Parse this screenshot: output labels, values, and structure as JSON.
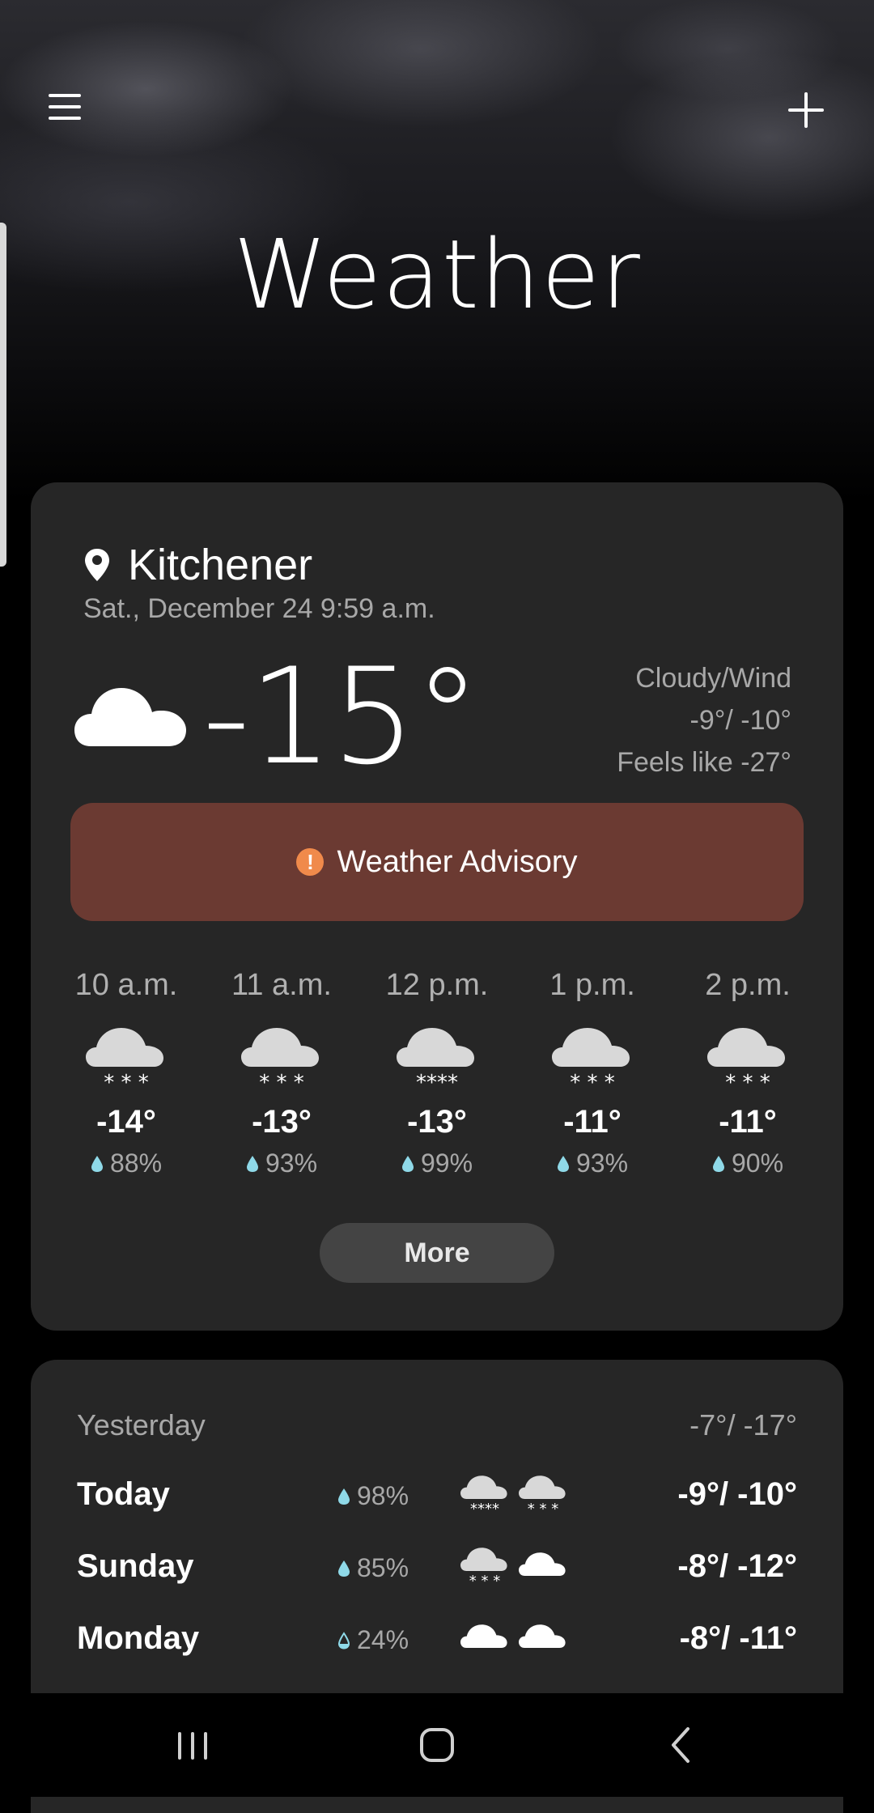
{
  "header": {
    "title": "Weather"
  },
  "current": {
    "city": "Kitchener",
    "datetime": "Sat., December 24 9:59 a.m.",
    "temperature": "-15°",
    "condition": "Cloudy/Wind",
    "high_low": "-9°/ -10°",
    "feels_like": "Feels like -27°",
    "icon": "cloud-icon"
  },
  "advisory": {
    "label": "Weather Advisory",
    "icon": "warning-icon",
    "color": "#6b3a32"
  },
  "hourly": [
    {
      "time": "10 a.m.",
      "temp": "-14°",
      "precip": "88%",
      "icon": "snow-cloud-icon"
    },
    {
      "time": "11 a.m.",
      "temp": "-13°",
      "precip": "93%",
      "icon": "snow-cloud-icon"
    },
    {
      "time": "12 p.m.",
      "temp": "-13°",
      "precip": "99%",
      "icon": "heavy-snow-cloud-icon"
    },
    {
      "time": "1 p.m.",
      "temp": "-11°",
      "precip": "93%",
      "icon": "snow-cloud-icon"
    },
    {
      "time": "2 p.m.",
      "temp": "-11°",
      "precip": "90%",
      "icon": "snow-cloud-icon"
    }
  ],
  "more_label": "More",
  "daily": {
    "yesterday": {
      "label": "Yesterday",
      "temps": "-7°/ -17°"
    },
    "days": [
      {
        "name": "Today",
        "precip": "98%",
        "icon_day": "heavy-snow-cloud-icon",
        "icon_night": "snow-cloud-icon",
        "temps": "-9°/ -10°"
      },
      {
        "name": "Sunday",
        "precip": "85%",
        "icon_day": "snow-cloud-icon",
        "icon_night": "cloud-icon",
        "temps": "-8°/ -12°"
      },
      {
        "name": "Monday",
        "precip": "24%",
        "icon_day": "cloud-icon",
        "icon_night": "cloud-icon",
        "temps": "-8°/ -11°"
      }
    ]
  },
  "colors": {
    "card": "#262626",
    "drop": "#8fd9e8",
    "muted_text": "#a8a8a8"
  }
}
